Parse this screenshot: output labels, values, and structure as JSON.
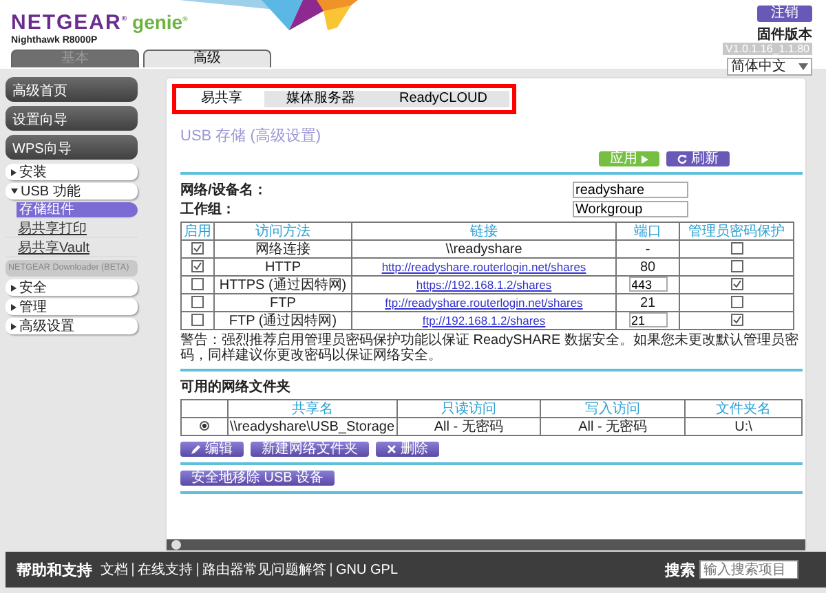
{
  "header": {
    "brand": "NETGEAR$^{®}$",
    "product": "genie$^{®}$",
    "model": "Nighthawk R8000P",
    "logout": "注销",
    "firmware_label": "固件版本",
    "firmware_version": "V1.0.1.16_1.1.80",
    "language": "简体中文"
  },
  "top_tabs": [
    {
      "label": "基本",
      "selected": false
    },
    {
      "label": "高级",
      "selected": true
    }
  ],
  "sidebar": [
    {
      "label": "高级首页",
      "kind": "main"
    },
    {
      "label": "设置向导",
      "kind": "main"
    },
    {
      "label": "WPS向导",
      "kind": "main"
    },
    {
      "label": "安装",
      "kind": "menu",
      "expanded": false
    },
    {
      "label": "USB 功能",
      "kind": "menu",
      "expanded": true,
      "children": [
        {
          "label": "存储组件",
          "selected": true
        },
        {
          "label": "易共享打印",
          "selected": false
        },
        {
          "label": "易共享Vault",
          "selected": false
        }
      ]
    },
    {
      "label": "NETGEAR Downloader (BETA)",
      "kind": "plain"
    },
    {
      "label": "安全",
      "kind": "menu",
      "expanded": false
    },
    {
      "label": "管理",
      "kind": "menu",
      "expanded": false
    },
    {
      "label": "高级设置",
      "kind": "menu",
      "expanded": false
    }
  ],
  "page_tabs": [
    {
      "label": "易共享",
      "selected": true
    },
    {
      "label": "媒体服务器",
      "selected": false
    },
    {
      "label": "ReadyCLOUD",
      "selected": false
    }
  ],
  "title": "USB 存储 (高级设置)",
  "actions": {
    "apply": "应用",
    "refresh": "刷新"
  },
  "fields": [
    {
      "label": "网络/设备名：",
      "value": "readyshare"
    },
    {
      "label": "工作组：",
      "value": "Workgroup"
    }
  ],
  "access_table": {
    "columns": [
      "启用",
      "访问方法",
      "链接",
      "端口",
      "管理员密码保护"
    ],
    "rows": [
      {
        "enabled": true,
        "method": "网络连接",
        "link": {
          "kind": "text",
          "text": "\\\\readyshare"
        },
        "port": {
          "kind": "text",
          "text": "-"
        },
        "password": false
      },
      {
        "enabled": true,
        "method": "HTTP",
        "link": {
          "kind": "link",
          "text": "http://readyshare.routerlogin.net/shares"
        },
        "port": {
          "kind": "text",
          "text": "80"
        },
        "password": false
      },
      {
        "enabled": false,
        "method": "HTTPS (通过因特网)",
        "link": {
          "kind": "link",
          "text": "https://192.168.1.2/shares"
        },
        "port": {
          "kind": "input",
          "text": "443"
        },
        "password": true
      },
      {
        "enabled": false,
        "method": "FTP",
        "link": {
          "kind": "link",
          "text": "ftp://readyshare.routerlogin.net/shares"
        },
        "port": {
          "kind": "text",
          "text": "21"
        },
        "password": false
      },
      {
        "enabled": false,
        "method": "FTP (通过因特网)",
        "link": {
          "kind": "link",
          "text": "ftp://192.168.1.2/shares"
        },
        "port": {
          "kind": "input",
          "text": "21"
        },
        "password": true
      }
    ]
  },
  "warning": "警告：强烈推荐启用管理员密码保护功能以保证 ReadySHARE 数据安全。如果您未更改默认管理员密码，同样建议你更改密码以保证网络安全。",
  "folders": {
    "title": "可用的网络文件夹",
    "columns": [
      "共享名",
      "只读访问",
      "写入访问",
      "文件夹名"
    ],
    "rows": [
      {
        "selected": true,
        "share": "\\\\readyshare\\USB_Storage",
        "read": "All - 无密码",
        "write": "All - 无密码",
        "folder": "U:\\"
      }
    ]
  },
  "folder_buttons": {
    "edit": "编辑",
    "create": "新建网络文件夹",
    "delete": "删除"
  },
  "remove_usb": "安全地移除 USB 设备",
  "footer": {
    "title": "帮助和支持",
    "links": [
      "文档",
      "在线支持",
      "路由器常见问题解答",
      "GNU GPL"
    ],
    "search_label": "搜索",
    "search_placeholder": "输入搜索项目"
  }
}
